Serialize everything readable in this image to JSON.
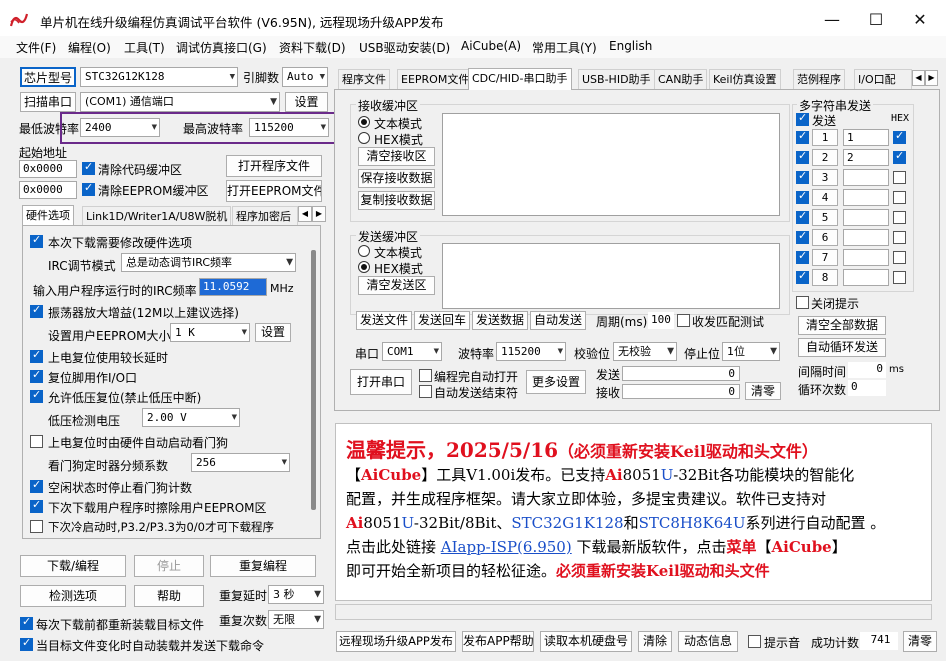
{
  "window": {
    "title": "单片机在线升级编程仿真调试平台软件 (V6.95N), 远程现场升级APP发布"
  },
  "menu": [
    "文件(F)",
    "编程(O)",
    "工具(T)",
    "调试仿真接口(G)",
    "资料下载(D)",
    "USB驱动安装(D)",
    "AiCube(A)",
    "常用工具(Y)",
    "English"
  ],
  "left": {
    "chip_btn": "芯片型号",
    "chip_value": "STC32G12K128",
    "pin_label": "引脚数",
    "pin_value": "Auto",
    "scan_btn": "扫描串口",
    "port_value": "(COM1) 通信端口",
    "settings_btn": "设置",
    "min_baud_label": "最低波特率",
    "min_baud_value": "2400",
    "max_baud_label": "最高波特率",
    "max_baud_value": "115200",
    "start_addr_label": "起始地址",
    "addr1": "0x0000",
    "addr2": "0x0000",
    "clear_code": "清除代码缓冲区",
    "clear_eeprom": "清除EEPROM缓冲区",
    "open_prog_btn": "打开程序文件",
    "open_eeprom_btn": "打开EEPROM文件",
    "tabs": [
      "硬件选项",
      "Link1D/Writer1A/U8W脱机",
      "程序加密后"
    ],
    "options": {
      "opt1": "本次下载需要修改硬件选项",
      "irc_mode_label": "IRC调节模式",
      "irc_mode_value": "总是动态调节IRC频率",
      "irc_freq_label": "输入用户程序运行时的IRC频率",
      "irc_freq_value": "11.0592",
      "irc_freq_unit": "MHz",
      "opt2": "振荡器放大增益(12M以上建议选择)",
      "eeprom_size_label": "设置用户EEPROM大小",
      "eeprom_size_value": "1   K",
      "eeprom_settings_btn": "设置",
      "opt3": "上电复位使用较长延时",
      "opt4": "复位脚用作I/O口",
      "opt5": "允许低压复位(禁止低压中断)",
      "lvd_label": "低压检测电压",
      "lvd_value": "2.00 V",
      "opt6": "上电复位时由硬件自动启动看门狗",
      "wdt_label": "看门狗定时器分频系数",
      "wdt_value": "256",
      "opt7": "空闲状态时停止看门狗计数",
      "opt8": "下次下载用户程序时擦除用户EEPROM区",
      "opt9": "下次冷启动时,P3.2/P3.3为0/0才可下载程序"
    },
    "download_btn": "下载/编程",
    "stop_btn": "停止",
    "reprog_btn": "重复编程",
    "detect_btn": "检测选项",
    "help_btn": "帮助",
    "repeat_delay_label": "重复延时",
    "repeat_delay_value": "3 秒",
    "repeat_count_label": "重复次数",
    "repeat_count_value": "无限",
    "reload_each": "每次下载前都重新装载目标文件",
    "auto_load": "当目标文件变化时自动装载并发送下载命令"
  },
  "right": {
    "tabs": [
      "程序文件",
      "EEPROM文件",
      "CDC/HID-串口助手",
      "USB-HID助手",
      "CAN助手",
      "Keil仿真设置",
      "范例程序",
      "I/O口配"
    ],
    "recv_group": "接收缓冲区",
    "recv_text_mode": "文本模式",
    "recv_hex_mode": "HEX模式",
    "clear_recv_btn": "清空接收区",
    "save_recv_btn": "保存接收数据",
    "copy_recv_btn": "复制接收数据",
    "send_group": "发送缓冲区",
    "send_text_mode": "文本模式",
    "send_hex_mode": "HEX模式",
    "clear_send_btn": "清空发送区",
    "multi_group": "多字符串发送",
    "multi_send": "发送",
    "multi_hex": "HEX",
    "multi_rows": [
      {
        "n": "1",
        "v": "1",
        "hex": true
      },
      {
        "n": "2",
        "v": "2",
        "hex": true
      },
      {
        "n": "3",
        "v": "",
        "hex": false
      },
      {
        "n": "4",
        "v": "",
        "hex": false
      },
      {
        "n": "5",
        "v": "",
        "hex": false
      },
      {
        "n": "6",
        "v": "",
        "hex": false
      },
      {
        "n": "7",
        "v": "",
        "hex": false
      },
      {
        "n": "8",
        "v": "",
        "hex": false
      }
    ],
    "close_hint": "关闭提示",
    "clear_all_btn": "清空全部数据",
    "auto_loop_btn": "自动循环发送",
    "interval_label": "间隔时间",
    "interval_value": "0",
    "interval_unit": "ms",
    "loop_count_label": "循环次数",
    "loop_count_value": "0",
    "send_file_btn": "发送文件",
    "send_cr_btn": "发送回车",
    "send_data_btn": "发送数据",
    "auto_send_btn": "自动发送",
    "period_label": "周期(ms)",
    "period_value": "100",
    "match_label": "收发匹配测试",
    "port_label": "串口",
    "port_value": "COM1",
    "baud_label": "波特率",
    "baud_value": "115200",
    "parity_label": "校验位",
    "parity_value": "无校验",
    "stop_label": "停止位",
    "stop_value": "1位",
    "open_port_btn": "打开串口",
    "auto_open_label": "编程完自动打开",
    "auto_end_label": "自动发送结束符",
    "more_btn": "更多设置",
    "tx_label": "发送",
    "tx_value": "0",
    "rx_label": "接收",
    "rx_value": "0",
    "clear_count_btn": "清零"
  },
  "info": {
    "line1a": "温馨提示，2025/5/16",
    "line1b": "（必须重新安装Keil驱动和头文件）",
    "line2a": "【",
    "line2b": "AiCube",
    "line2c": "】工具V1.00i发布。已支持",
    "line2d": "Ai",
    "line2e": "8051",
    "line2f": "U",
    "line2g": "-32Bit各功能模块的智能化",
    "line3": "配置，并生成程序框架。请大家立即体验，多提宝贵建议。软件已支持对",
    "line4a": "Ai",
    "line4b": "8051",
    "line4c": "U",
    "line4d": "-32Bit/8Bit、",
    "line4e": "STC32G1K128",
    "line4f": "和",
    "line4g": "STC8H8K64U",
    "line4h": "系列进行自动配置 。",
    "line5a": "点击此处链接 ",
    "line5b": "AIapp-ISP(6.950)",
    "line5c": " 下载最新版软件，点击",
    "line5d": "菜单",
    "line5e": "【",
    "line5f": "AiCube",
    "line5g": "】",
    "line6a": "即可开始全新项目的轻松征途。",
    "line6b": "必须重新安装Keil驱动和头文件"
  },
  "bottom": {
    "remote_btn": "远程现场升级APP发布",
    "publish_help_btn": "发布APP帮助",
    "read_disk_btn": "读取本机硬盘号",
    "clear_btn": "清除",
    "dynamic_btn": "动态信息",
    "beep_label": "提示音",
    "success_label": "成功计数",
    "success_value": "741",
    "clear_zero_btn": "清零"
  },
  "colors": {
    "accent": "#0a64c8",
    "highlight_box": "#6a2a8a",
    "red_text": "#e0101e",
    "blue_text": "#1a4fc9"
  }
}
